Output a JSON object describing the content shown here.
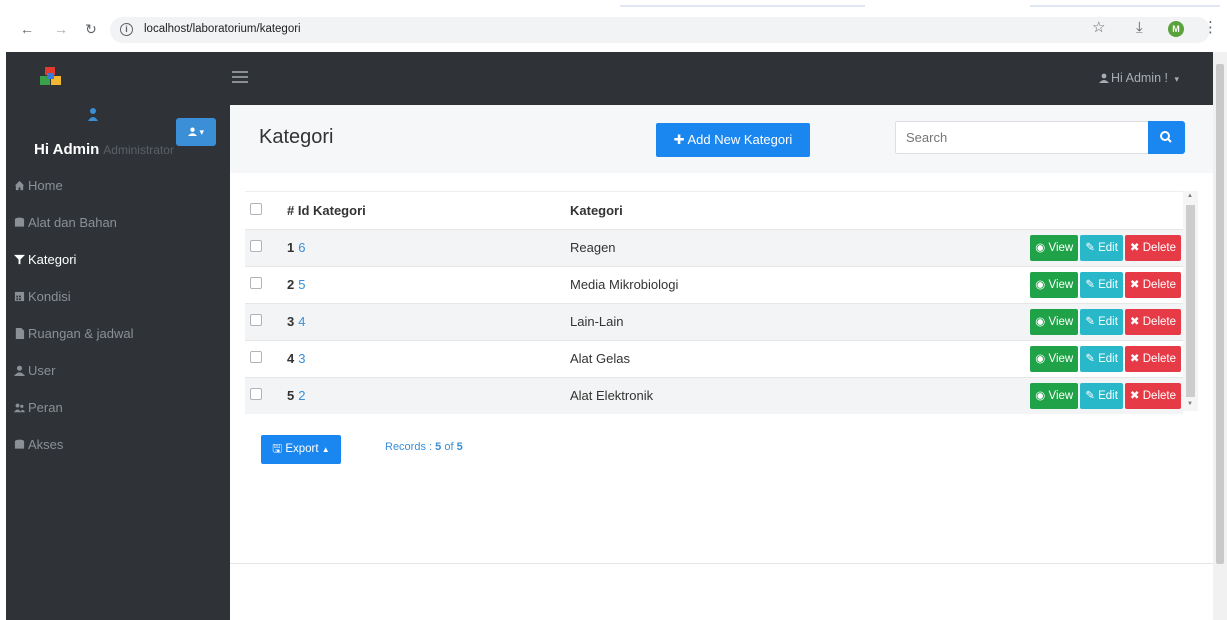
{
  "browser": {
    "url": "localhost/laboratorium/kategori",
    "profile_initial": "M"
  },
  "topbar": {
    "greeting": "Hi Admin !",
    "caret": "▾"
  },
  "sidebar": {
    "user_name": "Hi Admin",
    "user_role": "Administrator",
    "items": [
      {
        "label": "Home",
        "icon": "home-icon",
        "active": false
      },
      {
        "label": "Alat dan Bahan",
        "icon": "database-icon",
        "active": false
      },
      {
        "label": "Kategori",
        "icon": "filter-icon",
        "active": true
      },
      {
        "label": "Kondisi",
        "icon": "calculator-icon",
        "active": false
      },
      {
        "label": "Ruangan & jadwal",
        "icon": "file-icon",
        "active": false
      },
      {
        "label": "User",
        "icon": "user-icon",
        "active": false
      },
      {
        "label": "Peran",
        "icon": "users-icon",
        "active": false
      },
      {
        "label": "Akses",
        "icon": "database-icon",
        "active": false
      }
    ]
  },
  "header": {
    "title": "Kategori",
    "add_button": "Add New Kategori",
    "search_placeholder": "Search"
  },
  "table": {
    "columns": [
      "# Id Kategori",
      "Kategori"
    ],
    "rows": [
      {
        "no": "1",
        "id": "6",
        "kategori": "Reagen"
      },
      {
        "no": "2",
        "id": "5",
        "kategori": "Media Mikrobiologi"
      },
      {
        "no": "3",
        "id": "4",
        "kategori": "Lain-Lain"
      },
      {
        "no": "4",
        "id": "3",
        "kategori": "Alat Gelas"
      },
      {
        "no": "5",
        "id": "2",
        "kategori": "Alat Elektronik"
      }
    ],
    "actions": {
      "view": "View",
      "edit": "Edit",
      "delete": "Delete"
    }
  },
  "footer": {
    "export_label": "Export",
    "records_prefix": "Records :",
    "records_shown": "5",
    "records_of": "of",
    "records_total": "5"
  },
  "colors": {
    "navbar": "#2f3337",
    "primary": "#1a86f0",
    "view": "#20a348",
    "edit": "#28b8c9",
    "delete": "#e63a46"
  }
}
